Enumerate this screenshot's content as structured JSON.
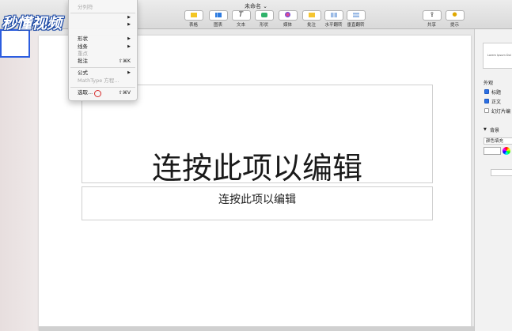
{
  "window": {
    "title": "未命名 ⌄"
  },
  "toolbar": {
    "buttons": [
      {
        "label": "表格"
      },
      {
        "label": "图表"
      },
      {
        "label": "文本"
      },
      {
        "label": "形状"
      },
      {
        "label": "媒体"
      },
      {
        "label": "批注"
      },
      {
        "label": "水平翻转"
      },
      {
        "label": "垂直翻转"
      },
      {
        "label": "共享"
      },
      {
        "label": "提示"
      }
    ]
  },
  "watermark": {
    "text": "秒懂视频"
  },
  "menu": {
    "items": [
      {
        "label": "分列符",
        "disabled": true
      },
      {
        "label": "形状",
        "submenu": true
      },
      {
        "label": "线条",
        "submenu": true
      },
      {
        "label": "重点",
        "disabled": true
      },
      {
        "label": "批注",
        "shortcut": "⇧⌘K"
      },
      {
        "label": "公式",
        "submenu": true
      },
      {
        "label": "MathType 方程...",
        "disabled": true
      },
      {
        "label": "选取...",
        "shortcut": "⇧⌘V"
      }
    ],
    "arrow_glyph": "▶"
  },
  "slide": {
    "title_placeholder": "连按此项以编辑",
    "body_placeholder": "连按此项以编辑"
  },
  "inspector": {
    "preview_text": "Lorem Ipsum Dol",
    "appearance_label": "外观",
    "checkboxes": [
      {
        "label": "标题",
        "checked": true
      },
      {
        "label": "正文",
        "checked": true
      },
      {
        "label": "幻灯片编",
        "checked": false
      }
    ],
    "background_label": "背景",
    "fill_select": "颜色填充"
  },
  "colors": {
    "accent": "#2b6fe3",
    "cursor_ring": "#d62a2a"
  }
}
